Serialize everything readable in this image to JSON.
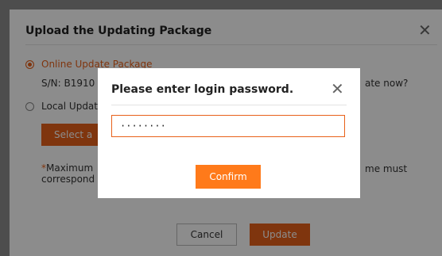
{
  "outer_dialog": {
    "title": "Upload the Updating Package",
    "close_glyph": "✕",
    "online_label": "Online Update Package",
    "sn_text": "S/N: B1910",
    "right_question_text": "ate now?",
    "local_label": "Local Updat",
    "select_button_label": "Select a",
    "note_left_star": "*",
    "note_left_line1": "Maximum",
    "note_left_line2": "correspond",
    "note_right_text": "me must",
    "cancel_label": "Cancel",
    "update_label": "Update"
  },
  "modal": {
    "title": "Please enter login password.",
    "close_glyph": "✕",
    "password_value": "········",
    "confirm_label": "Confirm"
  },
  "colors": {
    "accent": "#e8611a",
    "confirm": "#ff7a1a",
    "overlay": "rgba(0,0,0,0.45)"
  }
}
